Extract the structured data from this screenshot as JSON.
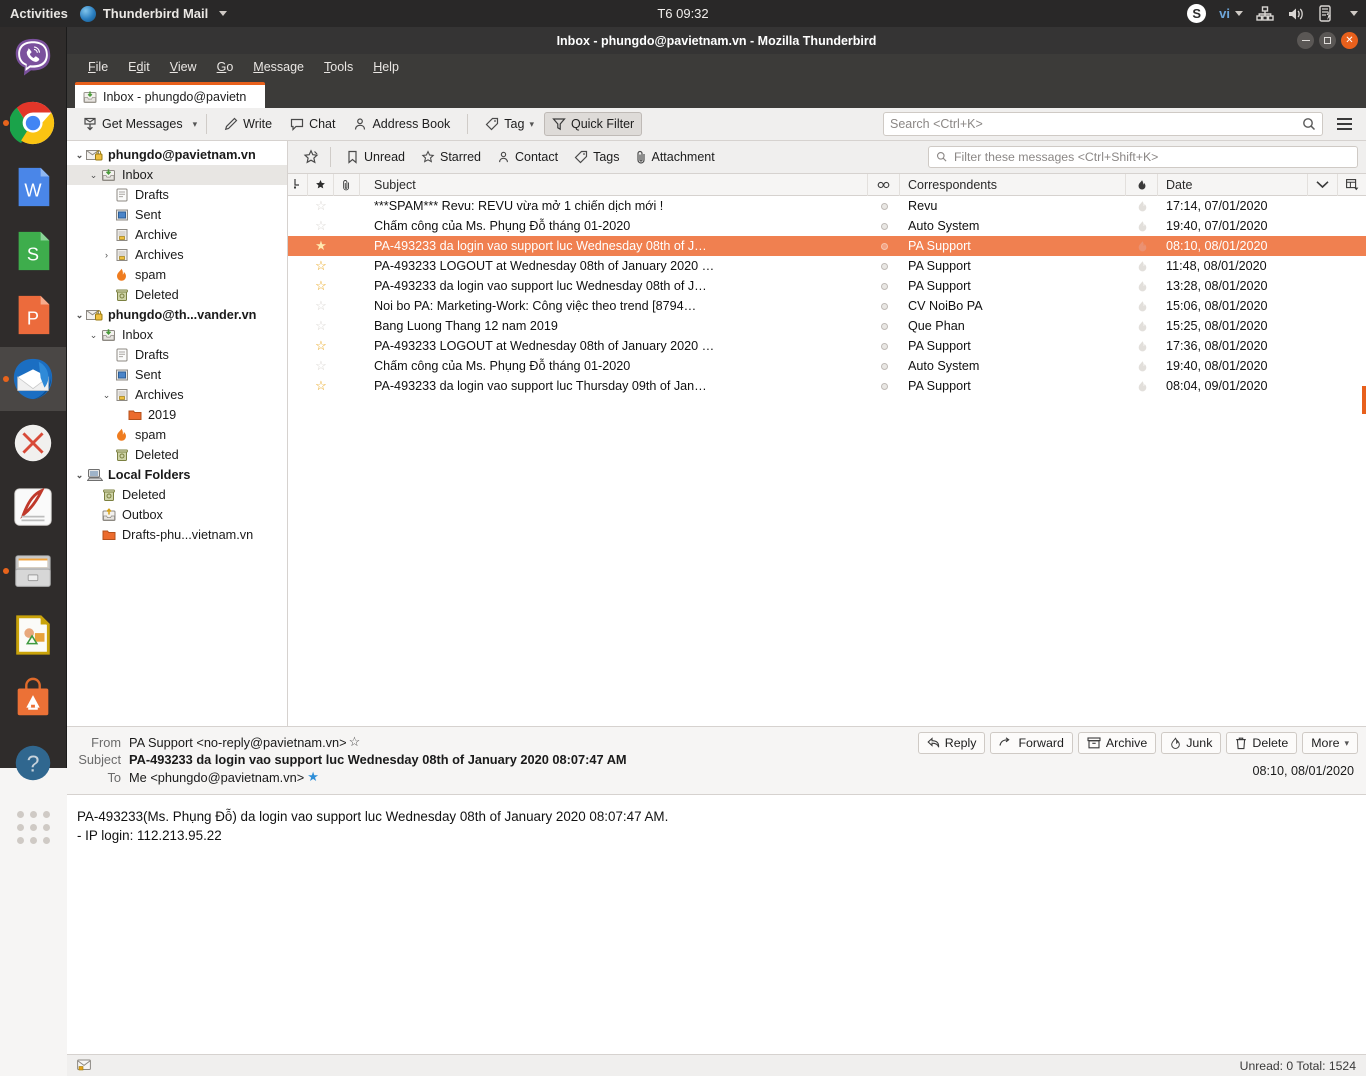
{
  "gnome": {
    "activities": "Activities",
    "app_name": "Thunderbird Mail",
    "clock": "T6 09:32",
    "skype": "S",
    "language": "vi",
    "icons": [
      "thunderbird-app-icon",
      "skype-icon",
      "language-indicator",
      "network-icon",
      "volume-icon",
      "battery-icon",
      "chevron-down-icon"
    ]
  },
  "dock": {
    "items": [
      {
        "name": "viber",
        "running": false
      },
      {
        "name": "google-chrome",
        "running": true
      },
      {
        "name": "wps-writer",
        "running": false
      },
      {
        "name": "wps-spreadsheets",
        "running": false
      },
      {
        "name": "wps-presentation",
        "running": false
      },
      {
        "name": "thunderbird",
        "running": true,
        "active": true
      },
      {
        "name": "unknown-app",
        "running": false
      },
      {
        "name": "evince-document-viewer",
        "running": false
      },
      {
        "name": "file-cabinet",
        "running": true
      },
      {
        "name": "libreoffice-draw",
        "running": false
      },
      {
        "name": "ubuntu-software",
        "running": false
      },
      {
        "name": "help",
        "running": false
      },
      {
        "name": "show-applications",
        "running": false
      }
    ]
  },
  "window": {
    "title": "Inbox - phungdo@pavietnam.vn - Mozilla Thunderbird",
    "controls": {
      "minimize": "minimize-button",
      "maximize": "maximize-button",
      "close": "close-button"
    }
  },
  "menubar": {
    "items": [
      "File",
      "Edit",
      "View",
      "Go",
      "Message",
      "Tools",
      "Help"
    ]
  },
  "tabs": [
    {
      "label": "Inbox - phungdo@pavietn",
      "icon": "inbox-icon",
      "active": true
    }
  ],
  "toolbar": {
    "get_messages": "Get Messages",
    "write": "Write",
    "chat": "Chat",
    "address_book": "Address Book",
    "tag": "Tag",
    "quick_filter": "Quick Filter",
    "search_placeholder": "Search <Ctrl+K>",
    "search_value": ""
  },
  "quick_filter": {
    "unread": "Unread",
    "starred": "Starred",
    "contact": "Contact",
    "tags": "Tags",
    "attachment": "Attachment",
    "filter_placeholder": "Filter these messages <Ctrl+Shift+K>",
    "filter_value": ""
  },
  "folders": [
    {
      "label": "phungdo@pavietnam.vn",
      "level": 0,
      "type": "account",
      "twisty": "down",
      "icon": "account-mail-icon",
      "selected": false
    },
    {
      "label": "Inbox",
      "level": 1,
      "type": "folder",
      "twisty": "down",
      "icon": "inbox-icon",
      "selected": true
    },
    {
      "label": "Drafts",
      "level": 2,
      "type": "folder",
      "twisty": "none",
      "icon": "drafts-icon",
      "selected": false
    },
    {
      "label": "Sent",
      "level": 2,
      "type": "folder",
      "twisty": "none",
      "icon": "sent-icon",
      "selected": false
    },
    {
      "label": "Archive",
      "level": 2,
      "type": "folder",
      "twisty": "none",
      "icon": "archive-icon",
      "selected": false
    },
    {
      "label": "Archives",
      "level": 2,
      "type": "folder",
      "twisty": "right",
      "icon": "archive-icon",
      "selected": false
    },
    {
      "label": "spam",
      "level": 2,
      "type": "folder",
      "twisty": "none",
      "icon": "spam-flame-icon",
      "selected": false
    },
    {
      "label": "Deleted",
      "level": 2,
      "type": "folder",
      "twisty": "none",
      "icon": "trash-icon",
      "selected": false
    },
    {
      "label": "phungdo@th...vander.vn",
      "level": 0,
      "type": "account",
      "twisty": "down",
      "icon": "account-mail-icon",
      "selected": false
    },
    {
      "label": "Inbox",
      "level": 1,
      "type": "folder",
      "twisty": "down",
      "icon": "inbox-icon",
      "selected": false
    },
    {
      "label": "Drafts",
      "level": 2,
      "type": "folder",
      "twisty": "none",
      "icon": "drafts-icon",
      "selected": false
    },
    {
      "label": "Sent",
      "level": 2,
      "type": "folder",
      "twisty": "none",
      "icon": "sent-icon",
      "selected": false
    },
    {
      "label": "Archives",
      "level": 2,
      "type": "folder",
      "twisty": "down",
      "icon": "archive-icon",
      "selected": false
    },
    {
      "label": "2019",
      "level": 3,
      "type": "folder",
      "twisty": "none",
      "icon": "folder-icon",
      "selected": false
    },
    {
      "label": "spam",
      "level": 2,
      "type": "folder",
      "twisty": "none",
      "icon": "spam-flame-icon",
      "selected": false
    },
    {
      "label": "Deleted",
      "level": 2,
      "type": "folder",
      "twisty": "none",
      "icon": "trash-icon",
      "selected": false
    },
    {
      "label": "Local Folders",
      "level": 0,
      "type": "local",
      "twisty": "down",
      "icon": "computer-icon",
      "selected": false
    },
    {
      "label": "Deleted",
      "level": 1,
      "type": "folder",
      "twisty": "none",
      "icon": "trash-icon",
      "selected": false
    },
    {
      "label": "Outbox",
      "level": 1,
      "type": "folder",
      "twisty": "none",
      "icon": "outbox-icon",
      "selected": false
    },
    {
      "label": "Drafts-phu...vietnam.vn",
      "level": 1,
      "type": "folder",
      "twisty": "none",
      "icon": "folder-icon",
      "selected": false
    }
  ],
  "columns": {
    "thread": "thread-column-icon",
    "star": "star-column-icon",
    "attachment": "attachment-column-icon",
    "subject": "Subject",
    "unread": "unread-column-icon",
    "correspondents": "Correspondents",
    "junk": "junk-column-icon",
    "date": "Date",
    "sort_dir": "chevron-down-icon",
    "select_cols": "column-picker-icon"
  },
  "messages": [
    {
      "subject": "***SPAM***  Revu: REVU vừa mở 1 chiến dịch mới !",
      "correspondent": "Revu",
      "date": "17:14, 07/01/2020",
      "starred": false,
      "selected": false
    },
    {
      "subject": "Chấm công của Ms. Phụng Đỗ tháng 01-2020",
      "correspondent": "Auto System",
      "date": "19:40, 07/01/2020",
      "starred": false,
      "selected": false
    },
    {
      "subject": "PA-493233 da login vao support luc Wednesday 08th of J…",
      "correspondent": "PA Support",
      "date": "08:10, 08/01/2020",
      "starred": true,
      "selected": true
    },
    {
      "subject": "PA-493233 LOGOUT at Wednesday 08th of January 2020 …",
      "correspondent": "PA Support",
      "date": "11:48, 08/01/2020",
      "starred": true,
      "selected": false
    },
    {
      "subject": "PA-493233 da login vao support luc Wednesday 08th of J…",
      "correspondent": "PA Support",
      "date": "13:28, 08/01/2020",
      "starred": true,
      "selected": false
    },
    {
      "subject": "Noi bo PA: Marketing-Work: Công việc theo trend [8794…",
      "correspondent": "CV NoiBo PA",
      "date": "15:06, 08/01/2020",
      "starred": false,
      "selected": false
    },
    {
      "subject": "Bang Luong Thang 12 nam 2019",
      "correspondent": "Que Phan",
      "date": "15:25, 08/01/2020",
      "starred": false,
      "selected": false
    },
    {
      "subject": "PA-493233 LOGOUT at Wednesday 08th of January 2020 …",
      "correspondent": "PA Support",
      "date": "17:36, 08/01/2020",
      "starred": true,
      "selected": false
    },
    {
      "subject": "Chấm công của Ms. Phụng Đỗ tháng 01-2020",
      "correspondent": "Auto System",
      "date": "19:40, 08/01/2020",
      "starred": false,
      "selected": false
    },
    {
      "subject": "PA-493233 da login vao support luc Thursday 09th of Jan…",
      "correspondent": "PA Support",
      "date": "08:04, 09/01/2020",
      "starred": true,
      "selected": false
    }
  ],
  "reading_pane": {
    "from_key": "From",
    "from_value": "PA Support <no-reply@pavietnam.vn>",
    "subject_key": "Subject",
    "subject_value": "PA-493233 da login vao support luc Wednesday 08th of January 2020 08:07:47 AM",
    "to_key": "To",
    "to_value": "Me <phungdo@pavietnam.vn>",
    "date": "08:10, 08/01/2020",
    "actions": {
      "reply": "Reply",
      "forward": "Forward",
      "archive": "Archive",
      "junk": "Junk",
      "delete": "Delete",
      "more": "More"
    },
    "body_line1": "PA-493233(Ms. Phụng Đỗ) da login vao support luc Wednesday 08th of January 2020 08:07:47 AM.",
    "body_line2": "- IP login: 112.213.95.22"
  },
  "status": {
    "icon": "mail-status-icon",
    "unread_total": "Unread: 0  Total: 1524"
  },
  "colors": {
    "accent": "#e8601c",
    "selection": "#f08050",
    "topbar": "#292828",
    "dock": "#2f2c2b",
    "titlebar": "#353434",
    "menubar": "#3c3b39",
    "star": "#e8a317"
  }
}
